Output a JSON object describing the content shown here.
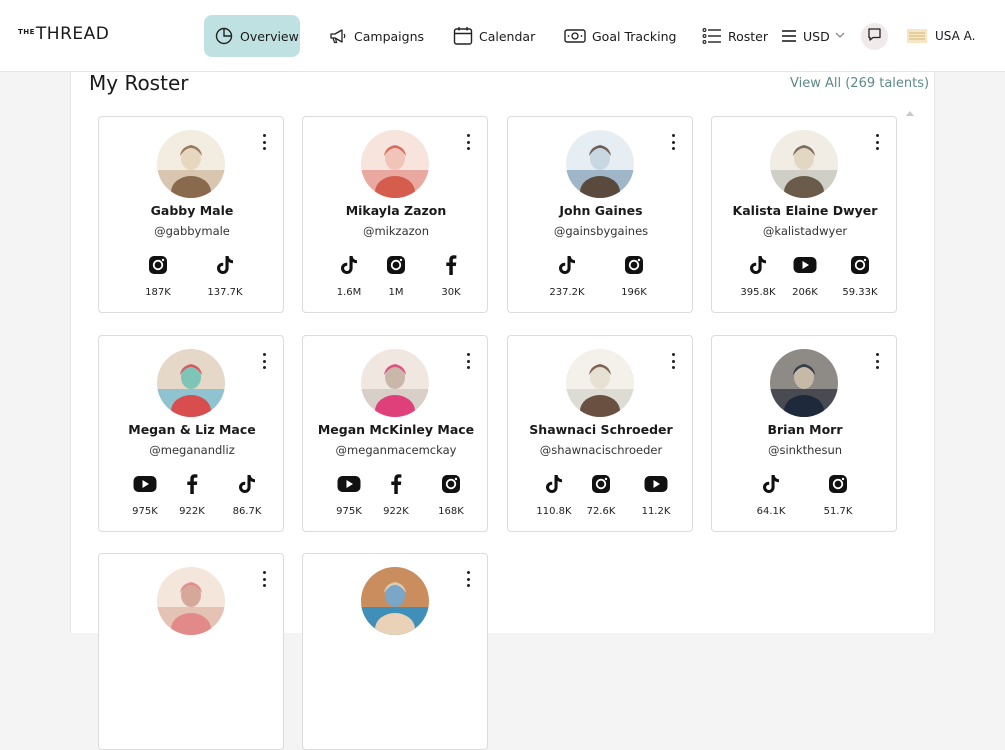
{
  "header": {
    "logo_prefix": "THE",
    "logo_name": "THREAD",
    "nav": {
      "overview": "Overview",
      "campaigns": "Campaigns",
      "calendar": "Calendar",
      "goal_tracking": "Goal Tracking",
      "roster": "Roster"
    },
    "currency": "USD",
    "user_label": "USA A."
  },
  "roster": {
    "title": "My Roster",
    "view_all": "View All (269 talents)",
    "cards": [
      {
        "name": "Gabby Male",
        "handle": "@gabbymale",
        "socials": [
          {
            "icon": "instagram",
            "count": "187K"
          },
          {
            "icon": "tiktok",
            "count": "137.7K"
          }
        ]
      },
      {
        "name": "Mikayla Zazon",
        "handle": "@mikzazon",
        "socials": [
          {
            "icon": "tiktok",
            "count": "1.6M"
          },
          {
            "icon": "instagram",
            "count": "1M"
          },
          {
            "icon": "facebook",
            "count": "30K"
          }
        ]
      },
      {
        "name": "John Gaines",
        "handle": "@gainsbygaines",
        "socials": [
          {
            "icon": "tiktok",
            "count": "237.2K"
          },
          {
            "icon": "instagram",
            "count": "196K"
          }
        ]
      },
      {
        "name": "Kalista Elaine Dwyer",
        "handle": "@kalistadwyer",
        "socials": [
          {
            "icon": "tiktok",
            "count": "395.8K"
          },
          {
            "icon": "youtube",
            "count": "206K"
          },
          {
            "icon": "instagram",
            "count": "59.33K"
          }
        ]
      },
      {
        "name": "Megan & Liz Mace",
        "handle": "@meganandliz",
        "socials": [
          {
            "icon": "youtube",
            "count": "975K"
          },
          {
            "icon": "facebook",
            "count": "922K"
          },
          {
            "icon": "tiktok",
            "count": "86.7K"
          }
        ]
      },
      {
        "name": "Megan McKinley Mace",
        "handle": "@meganmacemckay",
        "socials": [
          {
            "icon": "youtube",
            "count": "975K"
          },
          {
            "icon": "facebook",
            "count": "922K"
          },
          {
            "icon": "instagram",
            "count": "168K"
          }
        ]
      },
      {
        "name": "Shawnaci Schroeder",
        "handle": "@shawnacischroeder",
        "socials": [
          {
            "icon": "tiktok",
            "count": "110.8K"
          },
          {
            "icon": "instagram",
            "count": "72.6K"
          },
          {
            "icon": "youtube",
            "count": "11.2K"
          }
        ]
      },
      {
        "name": "Brian Morr",
        "handle": "@sinkthesun",
        "socials": [
          {
            "icon": "tiktok",
            "count": "64.1K"
          },
          {
            "icon": "instagram",
            "count": "51.7K"
          }
        ]
      },
      {
        "name": "",
        "handle": "",
        "socials": []
      },
      {
        "name": "",
        "handle": "",
        "socials": []
      }
    ]
  },
  "colors": {
    "accent": "#bfe1e1",
    "link": "#5e8a8a",
    "page_bg": "#f4f4f4"
  }
}
